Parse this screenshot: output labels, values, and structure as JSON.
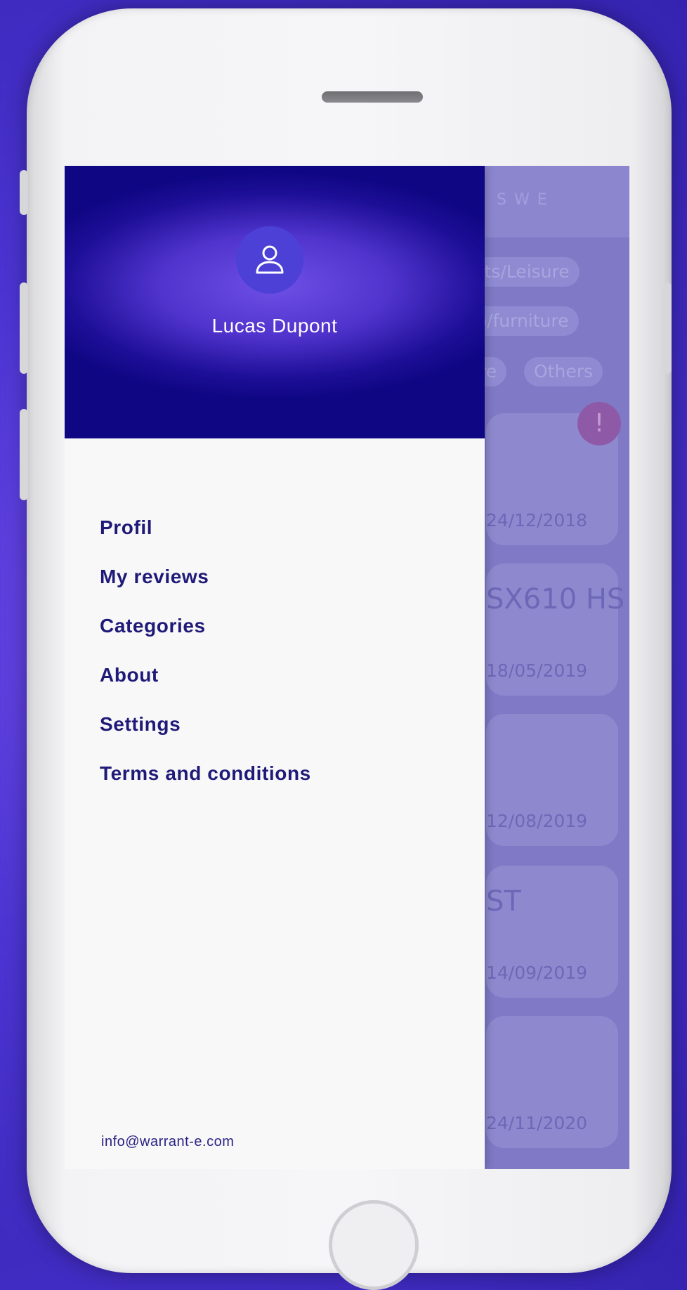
{
  "drawer": {
    "user_name": "Lucas Dupont",
    "menu": [
      {
        "label": "Profil"
      },
      {
        "label": "My reviews"
      },
      {
        "label": "Categories"
      },
      {
        "label": "About"
      },
      {
        "label": "Settings"
      },
      {
        "label": "Terms and conditions"
      }
    ],
    "contact_email": "info@warrant-e.com"
  },
  "background_app": {
    "header_title": "S W E",
    "chips": [
      "orts/Leisure",
      "co/furniture",
      "ure",
      "Others"
    ],
    "cards": [
      {
        "title": "",
        "date": "24/12/2018",
        "alert": "!"
      },
      {
        "title": "SX610 HS",
        "date": "18/05/2019"
      },
      {
        "title": "",
        "date": "12/08/2019"
      },
      {
        "title": "ST",
        "date": "14/09/2019"
      },
      {
        "title": "",
        "date": "24/11/2020"
      }
    ]
  },
  "colors": {
    "drawer_header": "#1e0f98",
    "menu_text": "#1f1a78",
    "overlay": "#7f79c6"
  },
  "icons": {
    "avatar": "user-icon"
  }
}
